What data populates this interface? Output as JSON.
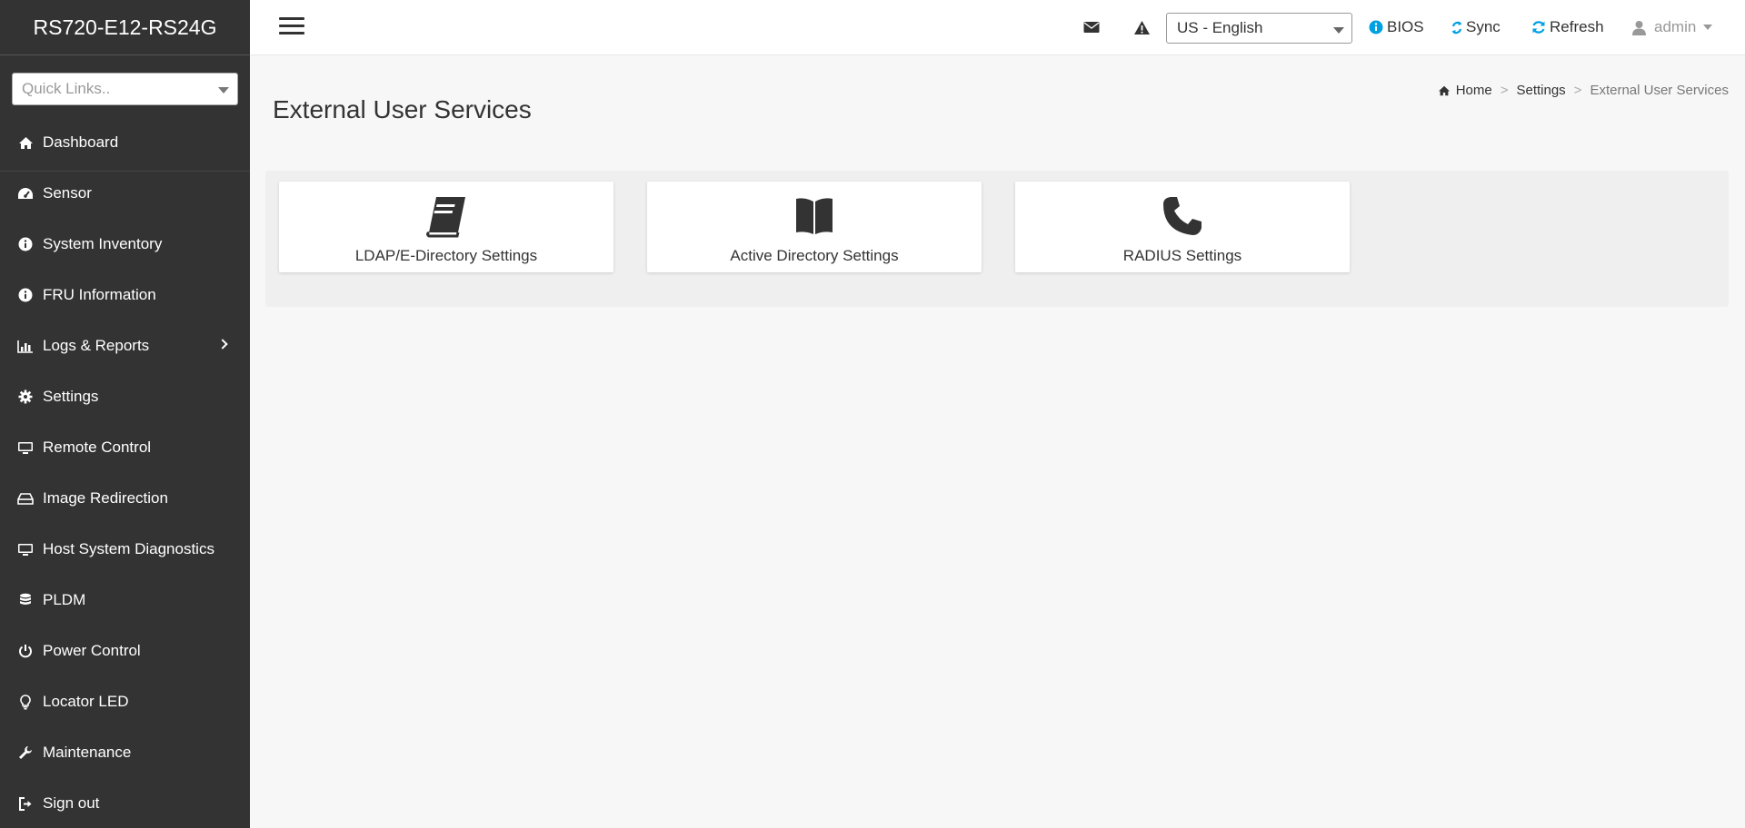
{
  "app": {
    "title": "RS720-E12-RS24G"
  },
  "quick_links": {
    "placeholder": "Quick Links.."
  },
  "sidebar": {
    "items": [
      {
        "label": "Dashboard",
        "icon": "home-icon"
      },
      {
        "label": "Sensor",
        "icon": "gauge-icon"
      },
      {
        "label": "System Inventory",
        "icon": "info-icon"
      },
      {
        "label": "FRU Information",
        "icon": "info-icon"
      },
      {
        "label": "Logs & Reports",
        "icon": "bar-chart-icon",
        "has_submenu": true
      },
      {
        "label": "Settings",
        "icon": "gear-icon"
      },
      {
        "label": "Remote Control",
        "icon": "monitor-icon"
      },
      {
        "label": "Image Redirection",
        "icon": "drive-icon"
      },
      {
        "label": "Host System Diagnostics",
        "icon": "monitor-icon"
      },
      {
        "label": "PLDM",
        "icon": "database-icon"
      },
      {
        "label": "Power Control",
        "icon": "power-icon"
      },
      {
        "label": "Locator LED",
        "icon": "lightbulb-icon"
      },
      {
        "label": "Maintenance",
        "icon": "wrench-icon"
      },
      {
        "label": "Sign out",
        "icon": "sign-out-icon"
      }
    ]
  },
  "topbar": {
    "language": "US - English",
    "bios_label": "BIOS",
    "sync_label": "Sync",
    "refresh_label": "Refresh",
    "user_label": "admin"
  },
  "page": {
    "title": "External User Services",
    "breadcrumb": {
      "home": "Home",
      "settings": "Settings",
      "current": "External User Services",
      "separator": ">"
    }
  },
  "cards": [
    {
      "label": "LDAP/E-Directory Settings",
      "icon": "book-icon"
    },
    {
      "label": "Active Directory Settings",
      "icon": "open-book-icon"
    },
    {
      "label": "RADIUS Settings",
      "icon": "phone-icon"
    }
  ],
  "colors": {
    "sidebar_bg": "#333333",
    "accent": "#00a0e3",
    "content_bg": "#f7f7f7"
  }
}
